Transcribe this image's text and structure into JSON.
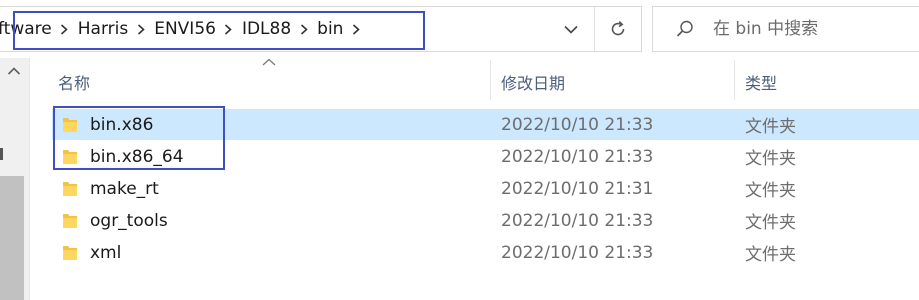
{
  "address_bar": {
    "path": [
      "ftware",
      "Harris",
      "ENVI56",
      "IDL88",
      "bin"
    ],
    "dropdown_icon": "chevron-down-icon",
    "refresh_icon": "refresh-icon"
  },
  "search": {
    "placeholder": "在 bin 中搜索",
    "icon": "search-icon"
  },
  "columns": {
    "name": "名称",
    "date": "修改日期",
    "type": "类型"
  },
  "rows": [
    {
      "name": "bin.x86",
      "date": "2022/10/10 21:33",
      "type": "文件夹",
      "selected": true
    },
    {
      "name": "bin.x86_64",
      "date": "2022/10/10 21:33",
      "type": "文件夹",
      "selected": false
    },
    {
      "name": "make_rt",
      "date": "2022/10/10 21:31",
      "type": "文件夹",
      "selected": false
    },
    {
      "name": "ogr_tools",
      "date": "2022/10/10 21:33",
      "type": "文件夹",
      "selected": false
    },
    {
      "name": "xml",
      "date": "2022/10/10 21:33",
      "type": "文件夹",
      "selected": false
    }
  ],
  "colors": {
    "selection": "#cce8ff",
    "highlight_box": "#3f4fbf",
    "folder": "#f5c244",
    "header_text": "#4c607a"
  }
}
